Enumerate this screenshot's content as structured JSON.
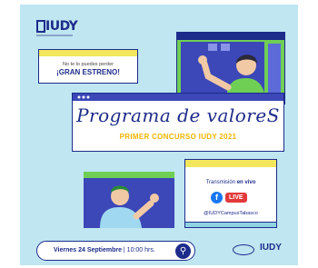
{
  "brand": {
    "logo_text": "IUDY"
  },
  "promo": {
    "line1": "No te lo puedes perder",
    "line2": "¡GRAN ESTRENO!"
  },
  "title": {
    "main": "Programa de valoreS",
    "sub": "PRIMER CONCURSO IUDY 2021"
  },
  "live": {
    "transmission_prefix": "Transmisión",
    "transmission_suffix": "en vivo",
    "facebook_icon": "f",
    "live_badge": "LIVE",
    "handle": "@IUDYCampusTabasco"
  },
  "event": {
    "day_bold": "Viernes 24 Septiembre",
    "time": "| 10:00 hrs."
  },
  "footer": {
    "logo_text": "IUDY"
  },
  "colors": {
    "background": "#bfe6f1",
    "navy": "#1d2b8a",
    "yellow": "#f2e65c",
    "green": "#6fcf55",
    "live": "#e23a3a"
  }
}
